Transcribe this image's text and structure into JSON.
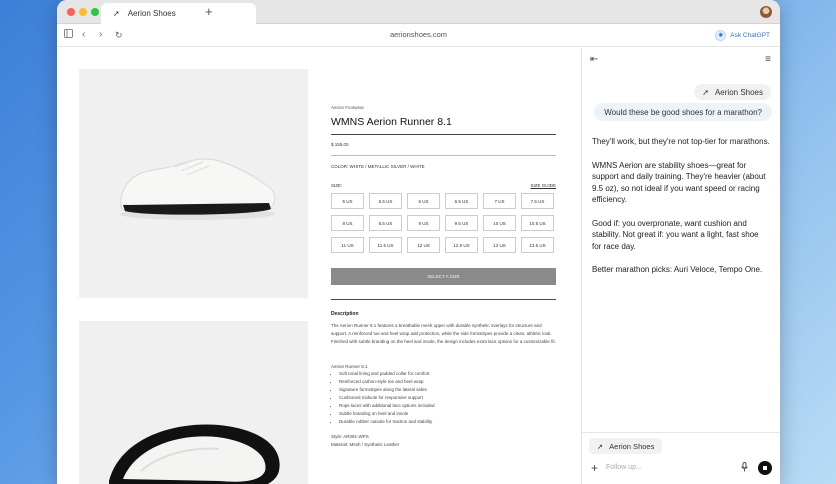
{
  "browser": {
    "tab_title": "Aerion Shoes",
    "url": "aerionshoes.com",
    "ask_chatgpt_label": "Ask ChatGPT"
  },
  "product": {
    "brand": "Aerion Footwear",
    "title": "WMNS Aerion Runner 8.1",
    "price": "$ 155.00",
    "color": "COLOR: WHITE / METALLIC SILVER / WHITE",
    "size_label": "SIZE:",
    "size_guide": "SIZE GUIDE",
    "sizes": [
      "5 US",
      "5.5 US",
      "6 US",
      "6.5 US",
      "7 US",
      "7.5 US",
      "8 US",
      "8.5 US",
      "9 US",
      "9.5 US",
      "10 US",
      "10.5 US",
      "11 US",
      "11.5 US",
      "12 US",
      "12.5 US",
      "13 US",
      "13.5 US"
    ],
    "select_button": "SELECT A SIZE",
    "description_heading": "Description",
    "description": "The Aerion Runner 8.1 features a breathable mesh upper with durable synthetic overlays for structure and support. A reinforced toe and heel wrap add protection, while the side formstripes provide a clean, athletic look. Finished with subtle branding on the heel and insole, the design includes extra lace options for a customizable fit.",
    "features_heading": "Aerion Runner 8.1",
    "features": [
      "Soft tonal lining and padded collar for comfort",
      "Reinforced carbon-style toe and heel wrap",
      "Signature formstripes along the lateral sides",
      "Cushioned midsole for responsive support",
      "Rope laces with additional lace options included",
      "Subtle branding on heel and insole",
      "Durable rubber outsole for traction and stability"
    ],
    "style": "Style: AR081-WPS",
    "material": "Material: Mesh / Synthetic Leather"
  },
  "chat": {
    "context_chip": "Aerion Shoes",
    "user_message": "Would these be good shoes for a marathon?",
    "reply": [
      "They'll work, but they're not top-tier for marathons.",
      "WMNS Aerion are stability shoes—great for support and daily training. They're heavier (about 9.5 oz), so not ideal if you want speed or racing efficiency.",
      "Good if: you overpronate, want cushion and stability. Not great if: you want a light, fast shoe for race day.",
      "Better marathon picks: Auri Veloce, Tempo One."
    ],
    "composer_chip": "Aerion Shoes",
    "composer_placeholder": "Follow up..."
  },
  "icons": {
    "favicon": "aerion-logo-icon",
    "sidebar": "sidebar-icon",
    "back": "chevron-left-icon",
    "forward": "chevron-right-icon",
    "reload": "reload-icon",
    "collapse": "collapse-panel-icon",
    "menu": "menu-icon",
    "plus": "plus-icon",
    "mic": "mic-icon",
    "stop": "stop-icon"
  },
  "colors": {
    "accent": "#2f6fd1",
    "select_button_bg": "#8a8a8a"
  }
}
